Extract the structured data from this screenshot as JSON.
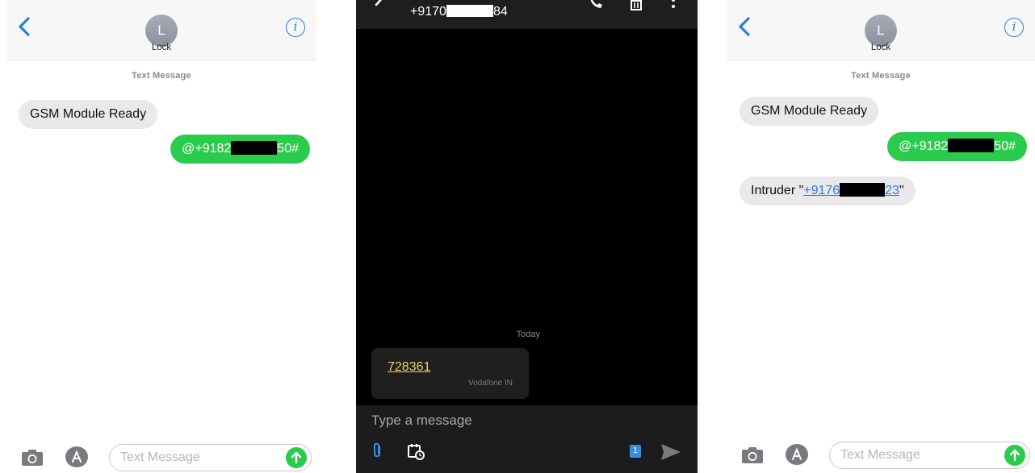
{
  "left_phone": {
    "contact_initial": "L",
    "contact_name": "Lock",
    "thread_label": "Text Message",
    "msg_in_1": "GSM Module Ready",
    "msg_out_1_prefix": "@+9182",
    "msg_out_1_suffix": "50#",
    "input_placeholder": "Text Message"
  },
  "android_phone": {
    "number_prefix": "+9170",
    "number_suffix": "84",
    "day_label": "Today",
    "message_code": "728361",
    "message_sender": "Vodafone IN",
    "compose_placeholder": "Type a message",
    "sim_badge": "1"
  },
  "right_phone": {
    "contact_initial": "L",
    "contact_name": "Lock",
    "thread_label": "Text Message",
    "msg_in_1": "GSM Module Ready",
    "msg_out_1_prefix": "@+9182",
    "msg_out_1_suffix": "50#",
    "msg_in_2_prefix": "Intruder \"",
    "msg_in_2_link_start": "+9176",
    "msg_in_2_link_end": "23",
    "msg_in_2_suffix": "\"",
    "input_placeholder": "Text Message"
  },
  "colors": {
    "ios_blue": "#2a7ce8",
    "ios_green": "#2bcb4e",
    "ios_gray_bubble": "#e9e9eb",
    "android_bg": "#000000",
    "android_link_yellow": "#f2cf6b"
  },
  "icons": [
    "back-chevron-icon",
    "info-icon",
    "camera-icon",
    "app-store-icon",
    "send-arrow-icon",
    "phone-icon",
    "delete-icon",
    "more-icon",
    "attach-icon",
    "schedule-icon",
    "sim-icon"
  ]
}
